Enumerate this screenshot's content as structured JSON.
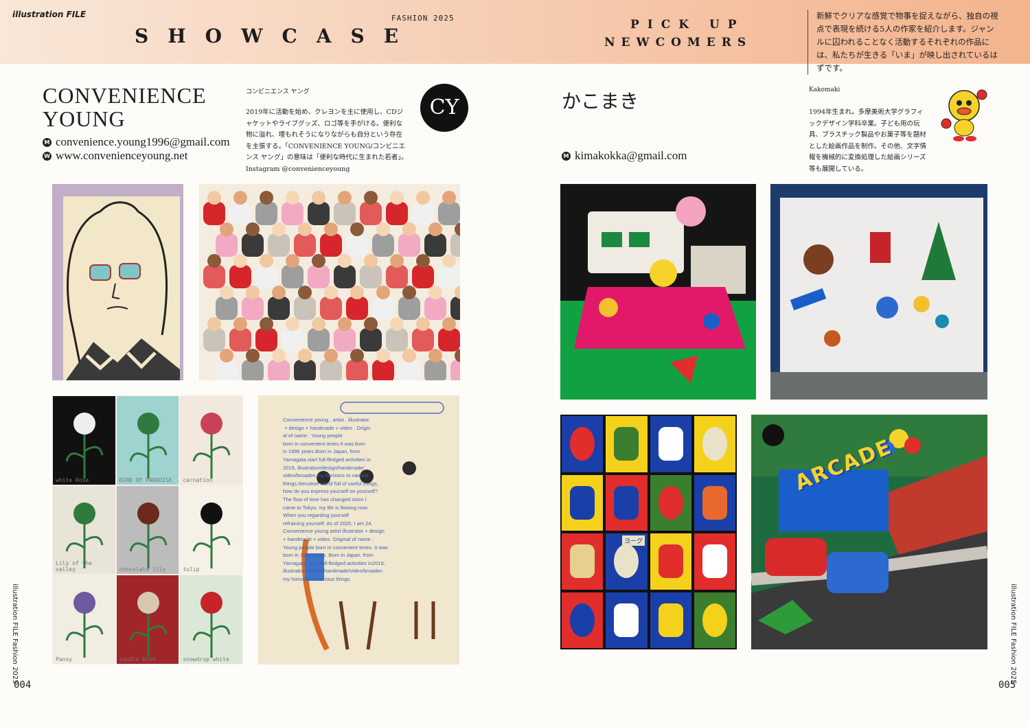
{
  "header": {
    "brand": "illustration FILE",
    "issue": "FASHION 2025",
    "showcase": "SHOWCASE",
    "pickup_line1": "PICK UP",
    "pickup_line2": "NEWCOMERS",
    "intro": "新鮮でクリアな感覚で物事を捉えながら、独自の視点で表現を続ける5人の作家を紹介します。ジャンルに囚われることなく活動するそれぞれの作品には、私たちが生きる「いま」が映し出されているはずです。"
  },
  "left_artist": {
    "name_line1": "CONVENIENCE",
    "name_line2": "YOUNG",
    "email_marker": "M",
    "email": "convenience.young1996@gmail.com",
    "web_marker": "W",
    "web": "www.convenienceyoung.net",
    "kana": "コンビニエンス ヤング",
    "bio": "2019年に活動を始め、クレヨンを主に使用し、CDジャケットやライブグッズ、ロゴ等を手がける。便利な物に溢れ、埋もれそうになりながらも自分という存在を主張する。「CONVENIENCE YOUNG/コンビニエンス ヤング」の意味は「便利な時代に生まれた若者」。Instagram @convenienceyoung",
    "logo": "CY",
    "note_text": "Convenience young , artist , illustrator\n + design + handmade + video . Origin\nal of name : Young people\nborn in convenient times.It was born\nin 1996 years.Born in Japan, from\nYamagata.start full-fledged activities in\n2019, illustration/design/handmade/\nvideo/broaden my horizons to various\nthings,Sensitive world full of useful things,\nhow do you express yourself on yourself?\nThe flow of time has changed since I\ncame to Tokyo, my life is flowing now.\nWhen you regarding yourself\nrefraining yourself. As of 2020, I am 24.\nConvenience young artist illustrator + design\n+ handmade + video. Original of name :\nYoung people born in convenient times. It was\nborn in 1996 years. Born in Japan, from\nYamagata. start full-fledged activities in2019,\nillustration/design/handmade/video/broaden\nmy horizons to various things.",
    "flowers": [
      {
        "label": "white Rose",
        "bg": "#111111",
        "color": "#eeeeee"
      },
      {
        "label": "BIRD OF PARADISE",
        "bg": "#9fd3cf",
        "color": "#2f7a3d"
      },
      {
        "label": "carnation",
        "bg": "#f1e9dd",
        "color": "#c9425b"
      },
      {
        "label": "Lily of the valley",
        "bg": "#e8e4d8",
        "color": "#2f7a3d"
      },
      {
        "label": "chocolate lily",
        "bg": "#bcbcbc",
        "color": "#6b2a1d"
      },
      {
        "label": "tulip",
        "bg": "#f5f1e6",
        "color": "#111111"
      },
      {
        "label": "Pansy",
        "bg": "#f1ede2",
        "color": "#6f5aa0"
      },
      {
        "label": "candle Bush",
        "bg": "#a0262a",
        "color": "#d8c8b0"
      },
      {
        "label": "snowdrop white",
        "bg": "#dbe8d7",
        "color": "#c5242b"
      }
    ]
  },
  "right_artist": {
    "name": "かこまき",
    "email_marker": "M",
    "email": "kimakokka@gmail.com",
    "romaji": "Kakomaki",
    "bio": "1994年生まれ。多摩美術大学グラフィックデザイン学科卒業。子ども用の玩具、プラスチック製品やお菓子等を題材とした絵画作品を制作。その他、文字情報を機械的に変換処理した絵画シリーズ等も展開している。",
    "arcade_sign": "ARCADE",
    "bottle_label": "ヨーグ",
    "grid": [
      {
        "bg": "#1b3fa8",
        "fg": "#e12d2b"
      },
      {
        "bg": "#f4d21c",
        "fg": "#3b7e2f"
      },
      {
        "bg": "#1b3fa8",
        "fg": "#ffffff"
      },
      {
        "bg": "#f4d21c",
        "fg": "#e9e2c8"
      },
      {
        "bg": "#f4d21c",
        "fg": "#1b3fa8"
      },
      {
        "bg": "#e12d2b",
        "fg": "#1b3fa8"
      },
      {
        "bg": "#3b7e2f",
        "fg": "#e12d2b"
      },
      {
        "bg": "#1b3fa8",
        "fg": "#e8692e"
      },
      {
        "bg": "#e12d2b",
        "fg": "#e6d08f"
      },
      {
        "bg": "#1b3fa8",
        "fg": "#e9e2c8"
      },
      {
        "bg": "#f4d21c",
        "fg": "#e12d2b"
      },
      {
        "bg": "#e12d2b",
        "fg": "#ffffff"
      },
      {
        "bg": "#e12d2b",
        "fg": "#1b3fa8"
      },
      {
        "bg": "#1b3fa8",
        "fg": "#ffffff"
      },
      {
        "bg": "#1b3fa8",
        "fg": "#f4d21c"
      },
      {
        "bg": "#3b7e2f",
        "fg": "#f4d21c"
      }
    ]
  },
  "side_left": "illustration FILE Fashion 2025",
  "side_right": "illustration FILE Fashion 2025",
  "page_left": "004",
  "page_right": "005"
}
